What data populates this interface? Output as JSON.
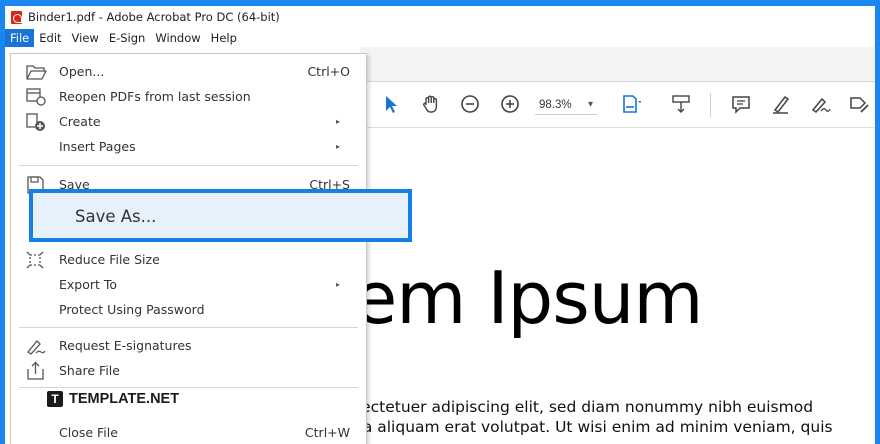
{
  "window": {
    "title": "Binder1.pdf - Adobe Acrobat Pro DC (64-bit)"
  },
  "menubar": {
    "items": [
      "File",
      "Edit",
      "View",
      "E-Sign",
      "Window",
      "Help"
    ]
  },
  "toolbar": {
    "zoom": "98.3%",
    "zoom_caret": "▾"
  },
  "file_menu": {
    "open": {
      "label": "Open...",
      "shortcut": "Ctrl+O"
    },
    "reopen": {
      "label": "Reopen PDFs from last session"
    },
    "create": {
      "label": "Create"
    },
    "insert_pages": {
      "label": "Insert Pages"
    },
    "save": {
      "label": "Save",
      "shortcut": "Ctrl+S"
    },
    "save_as": {
      "label": "Save As..."
    },
    "reduce_file_size": {
      "label": "Reduce File Size"
    },
    "export_to": {
      "label": "Export To"
    },
    "protect": {
      "label": "Protect Using Password"
    },
    "request_esig": {
      "label": "Request E-signatures"
    },
    "share": {
      "label": "Share File"
    },
    "close": {
      "label": "Close File",
      "shortcut": "Ctrl+W"
    },
    "submenu_arrow": "▸"
  },
  "document": {
    "heading": "em Ipsum",
    "line1": "sectetuer adipiscing elit, sed diam nonummy nibh euismod",
    "line2": "na aliquam erat volutpat. Ut wisi enim ad minim veniam, quis"
  },
  "watermark": {
    "logo_letter": "T",
    "text": "TEMPLATE.NET"
  },
  "colors": {
    "frame": "#1a87f0",
    "highlight_border": "#1480e4",
    "highlight_fill": "#e6f1fb",
    "acrobat_red": "#d9271c",
    "toolbar_blue": "#1a73d8"
  }
}
